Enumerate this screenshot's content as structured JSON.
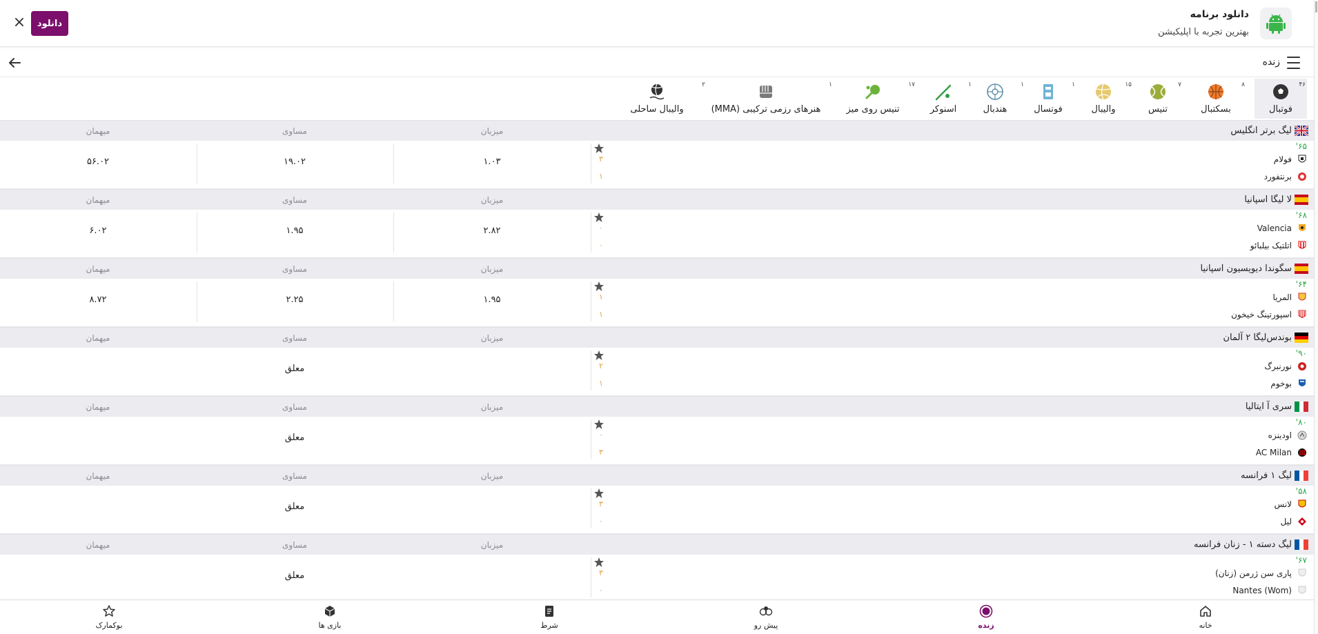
{
  "banner": {
    "app_title": "دانلود برنامه",
    "app_subtitle": "بهترین تجربه با اپلیکیشن",
    "download_label": "دانلود",
    "close_glyph": "×",
    "accent": "#7b0f6b"
  },
  "header": {
    "title": "زنده"
  },
  "sports": [
    {
      "label": "فوتبال",
      "count": "۴۶",
      "icon": "soccer-ball-icon",
      "active": true
    },
    {
      "label": "بسکتبال",
      "count": "۸",
      "icon": "basketball-icon"
    },
    {
      "label": "تنیس",
      "count": "۷",
      "icon": "tennis-ball-icon"
    },
    {
      "label": "والیبال",
      "count": "۱۵",
      "icon": "volleyball-icon"
    },
    {
      "label": "فوتسال",
      "count": "۱",
      "icon": "futsal-icon"
    },
    {
      "label": "هندبال",
      "count": "۱",
      "icon": "handball-icon"
    },
    {
      "label": "اسنوکر",
      "count": "۱",
      "icon": "snooker-cue-icon"
    },
    {
      "label": "تنیس روی میز",
      "count": "۱۷",
      "icon": "table-tennis-icon"
    },
    {
      "label": "هنرهای رزمی ترکیبی (MMA)",
      "count": "۱",
      "icon": "mma-glove-icon"
    },
    {
      "label": "والیبال ساحلی",
      "count": "۲",
      "icon": "beach-volleyball-icon"
    }
  ],
  "column_labels": {
    "host": "میزبان",
    "draw": "مساوی",
    "away": "میهمان"
  },
  "leagues": [
    {
      "name": "لیگ برتر انگلیس",
      "flag": "england-uk-flag",
      "minute": "'۶۵",
      "home": "فولام",
      "away": "برنتفورد",
      "home_score": "۳",
      "away_score": "۱",
      "odds": {
        "host": "۱.۰۳",
        "draw": "۱۹.۰۲",
        "away": "۵۶.۰۲"
      }
    },
    {
      "name": "لا لیگا اسپانیا",
      "flag": "spain-flag",
      "minute": "'۶۸",
      "home": "Valencia",
      "away": "اتلتیک بیلبائو",
      "home_score": "۰",
      "away_score": "۰",
      "odds": {
        "host": "۲.۸۲",
        "draw": "۱.۹۵",
        "away": "۶.۰۲"
      }
    },
    {
      "name": "سگوندا دیویسیون اسپانیا",
      "flag": "spain-flag",
      "minute": "'۶۴",
      "home": "المریا",
      "away": "اسپورتینگ خیخون",
      "home_score": "۱",
      "away_score": "۱",
      "odds": {
        "host": "۱.۹۵",
        "draw": "۲.۲۵",
        "away": "۸.۷۲"
      }
    },
    {
      "name": "بوندس‌لیگا ۲ آلمان",
      "flag": "germany-flag",
      "minute": "'۹۰",
      "home": "نورنبرگ",
      "away": "بوخوم",
      "home_score": "۲",
      "away_score": "۱",
      "suspended": "معلق"
    },
    {
      "name": "سری آ ایتالیا",
      "flag": "italy-flag",
      "minute": "'۸۰",
      "home": "اودینزه",
      "away": "AC Milan",
      "home_score": "۰",
      "away_score": "۳",
      "suspended": "معلق"
    },
    {
      "name": "لیگ ۱ فرانسه",
      "flag": "france-flag",
      "minute": "'۵۸",
      "home": "لانس",
      "away": "لیل",
      "home_score": "۳",
      "away_score": "۰",
      "suspended": "معلق"
    },
    {
      "name": "لیگ دسته ۱ - زنان فرانسه",
      "flag": "france-flag",
      "minute": "'۶۷",
      "home": "پاری سن ژرمن (زنان)",
      "away": "Nantes (Wom)",
      "home_score": "۳",
      "away_score": "۰",
      "suspended": "معلق"
    }
  ],
  "bottom_nav": [
    {
      "label": "خانه",
      "icon": "home-icon"
    },
    {
      "label": "زنده",
      "icon": "live-icon",
      "active": true
    },
    {
      "label": "پیش رو",
      "icon": "upcoming-balls-icon"
    },
    {
      "label": "شرط",
      "icon": "betslip-icon"
    },
    {
      "label": "بازی ها",
      "icon": "games-cube-icon"
    },
    {
      "label": "بوکمارک",
      "icon": "bookmark-star-icon"
    }
  ]
}
